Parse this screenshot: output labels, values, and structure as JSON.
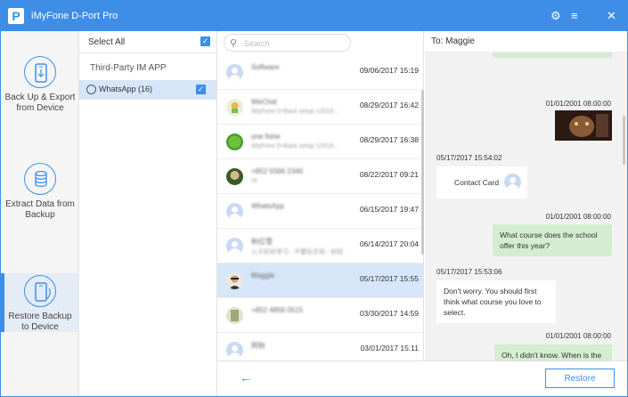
{
  "app": {
    "title": "iMyFone D-Port Pro",
    "logo_letter": "P"
  },
  "titlebar": {
    "settings_icon": "gear-icon",
    "menu_icon": "menu-icon",
    "close_icon": "close-icon",
    "settings_glyph": "⚙",
    "menu_glyph": "≡",
    "close_glyph": "✕"
  },
  "sidebar": {
    "items": [
      {
        "label": "Back Up & Export from Device",
        "icon": "phone-export-icon"
      },
      {
        "label": "Extract Data from Backup",
        "icon": "database-icon"
      },
      {
        "label": "Restore Backup to Device",
        "icon": "phone-restore-icon"
      }
    ],
    "active_index": 2
  },
  "filter": {
    "select_all_label": "Select All",
    "section_title": "Third-Party IM APP",
    "apps": [
      {
        "label": "WhatsApp (16)",
        "checked": true
      }
    ]
  },
  "search": {
    "placeholder": "Search"
  },
  "conversations": [
    {
      "name": "Software",
      "sub": "",
      "date": "09/06/2017 15:19"
    },
    {
      "name": "WeChat",
      "sub": "iMyFone D-Back setup 12019...",
      "date": "08/29/2017 16:42"
    },
    {
      "name": "one fishe",
      "sub": "iMyFone D-Back setup 12019...",
      "date": "08/29/2017 16:38"
    },
    {
      "name": "+852 5566 2346",
      "sub": "Hi",
      "date": "08/22/2017 09:21"
    },
    {
      "name": "WhatsApp",
      "sub": "",
      "date": "06/15/2017 19:47"
    },
    {
      "name": "秋红雪",
      "sub": "儿子好好学习 - 不要玩手机 - 好好",
      "date": "06/14/2017 20:04"
    },
    {
      "name": "Maggie",
      "sub": "",
      "date": "05/17/2017 15:55"
    },
    {
      "name": "+852 4856 0515",
      "sub": "",
      "date": "03/30/2017 14:59"
    },
    {
      "name": "阿秋",
      "sub": "",
      "date": "03/01/2017 15:11"
    }
  ],
  "selected_conversation_index": 6,
  "chat": {
    "to_label": "To:  Maggie",
    "messages": [
      {
        "ts": "01/01/2001 08:00:00",
        "type": "image",
        "dir": "out"
      },
      {
        "ts": "05/17/2017 15:54:02",
        "type": "contact",
        "dir": "in",
        "text": "Contact Card"
      },
      {
        "ts": "01/01/2001 08:00:00",
        "type": "text",
        "dir": "out",
        "text": "What course does the school offer this year?"
      },
      {
        "ts": "05/17/2017 15:53:06",
        "type": "text",
        "dir": "in",
        "text": "Don't worry. You should first think what course you love to select."
      },
      {
        "ts": "01/01/2001 08:00:00",
        "type": "text",
        "dir": "out",
        "text": "Oh, I didn't know. When is the"
      }
    ]
  },
  "footer": {
    "back_icon": "arrow-left-icon",
    "back_glyph": "←",
    "restore_label": "Restore"
  },
  "colors": {
    "accent": "#3e8ee8",
    "selected_row": "#d6e6f8",
    "outgoing_bubble": "#d4edd0"
  }
}
